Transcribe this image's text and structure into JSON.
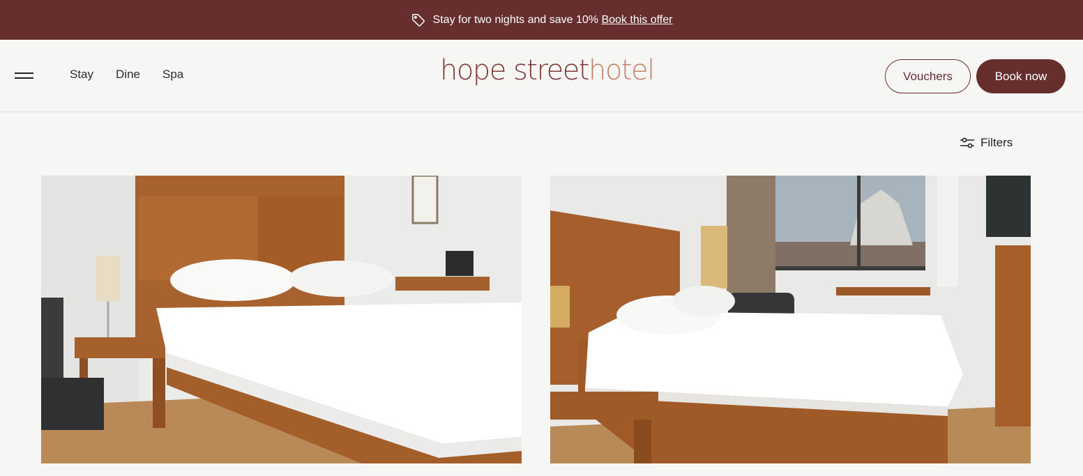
{
  "promo": {
    "text": "Stay for two nights and save 10%",
    "link": "Book this offer",
    "icon": "tag-icon"
  },
  "header": {
    "menu_icon": "hamburger-menu-icon",
    "nav": [
      {
        "label": "Stay"
      },
      {
        "label": "Dine"
      },
      {
        "label": "Spa"
      }
    ],
    "logo": {
      "part1": "hope street",
      "part2": "hotel"
    },
    "vouchers_label": "Vouchers",
    "book_label": "Book now"
  },
  "filters": {
    "label": "Filters",
    "icon": "sliders-icon"
  },
  "colors": {
    "brand": "#662f2e",
    "background": "#f6f6f4",
    "logo_dark": "#7e3a34",
    "logo_light": "#c4826c"
  },
  "rooms": [
    {
      "image": "hotel-room-bed-photo"
    },
    {
      "image": "hotel-room-window-photo"
    }
  ]
}
